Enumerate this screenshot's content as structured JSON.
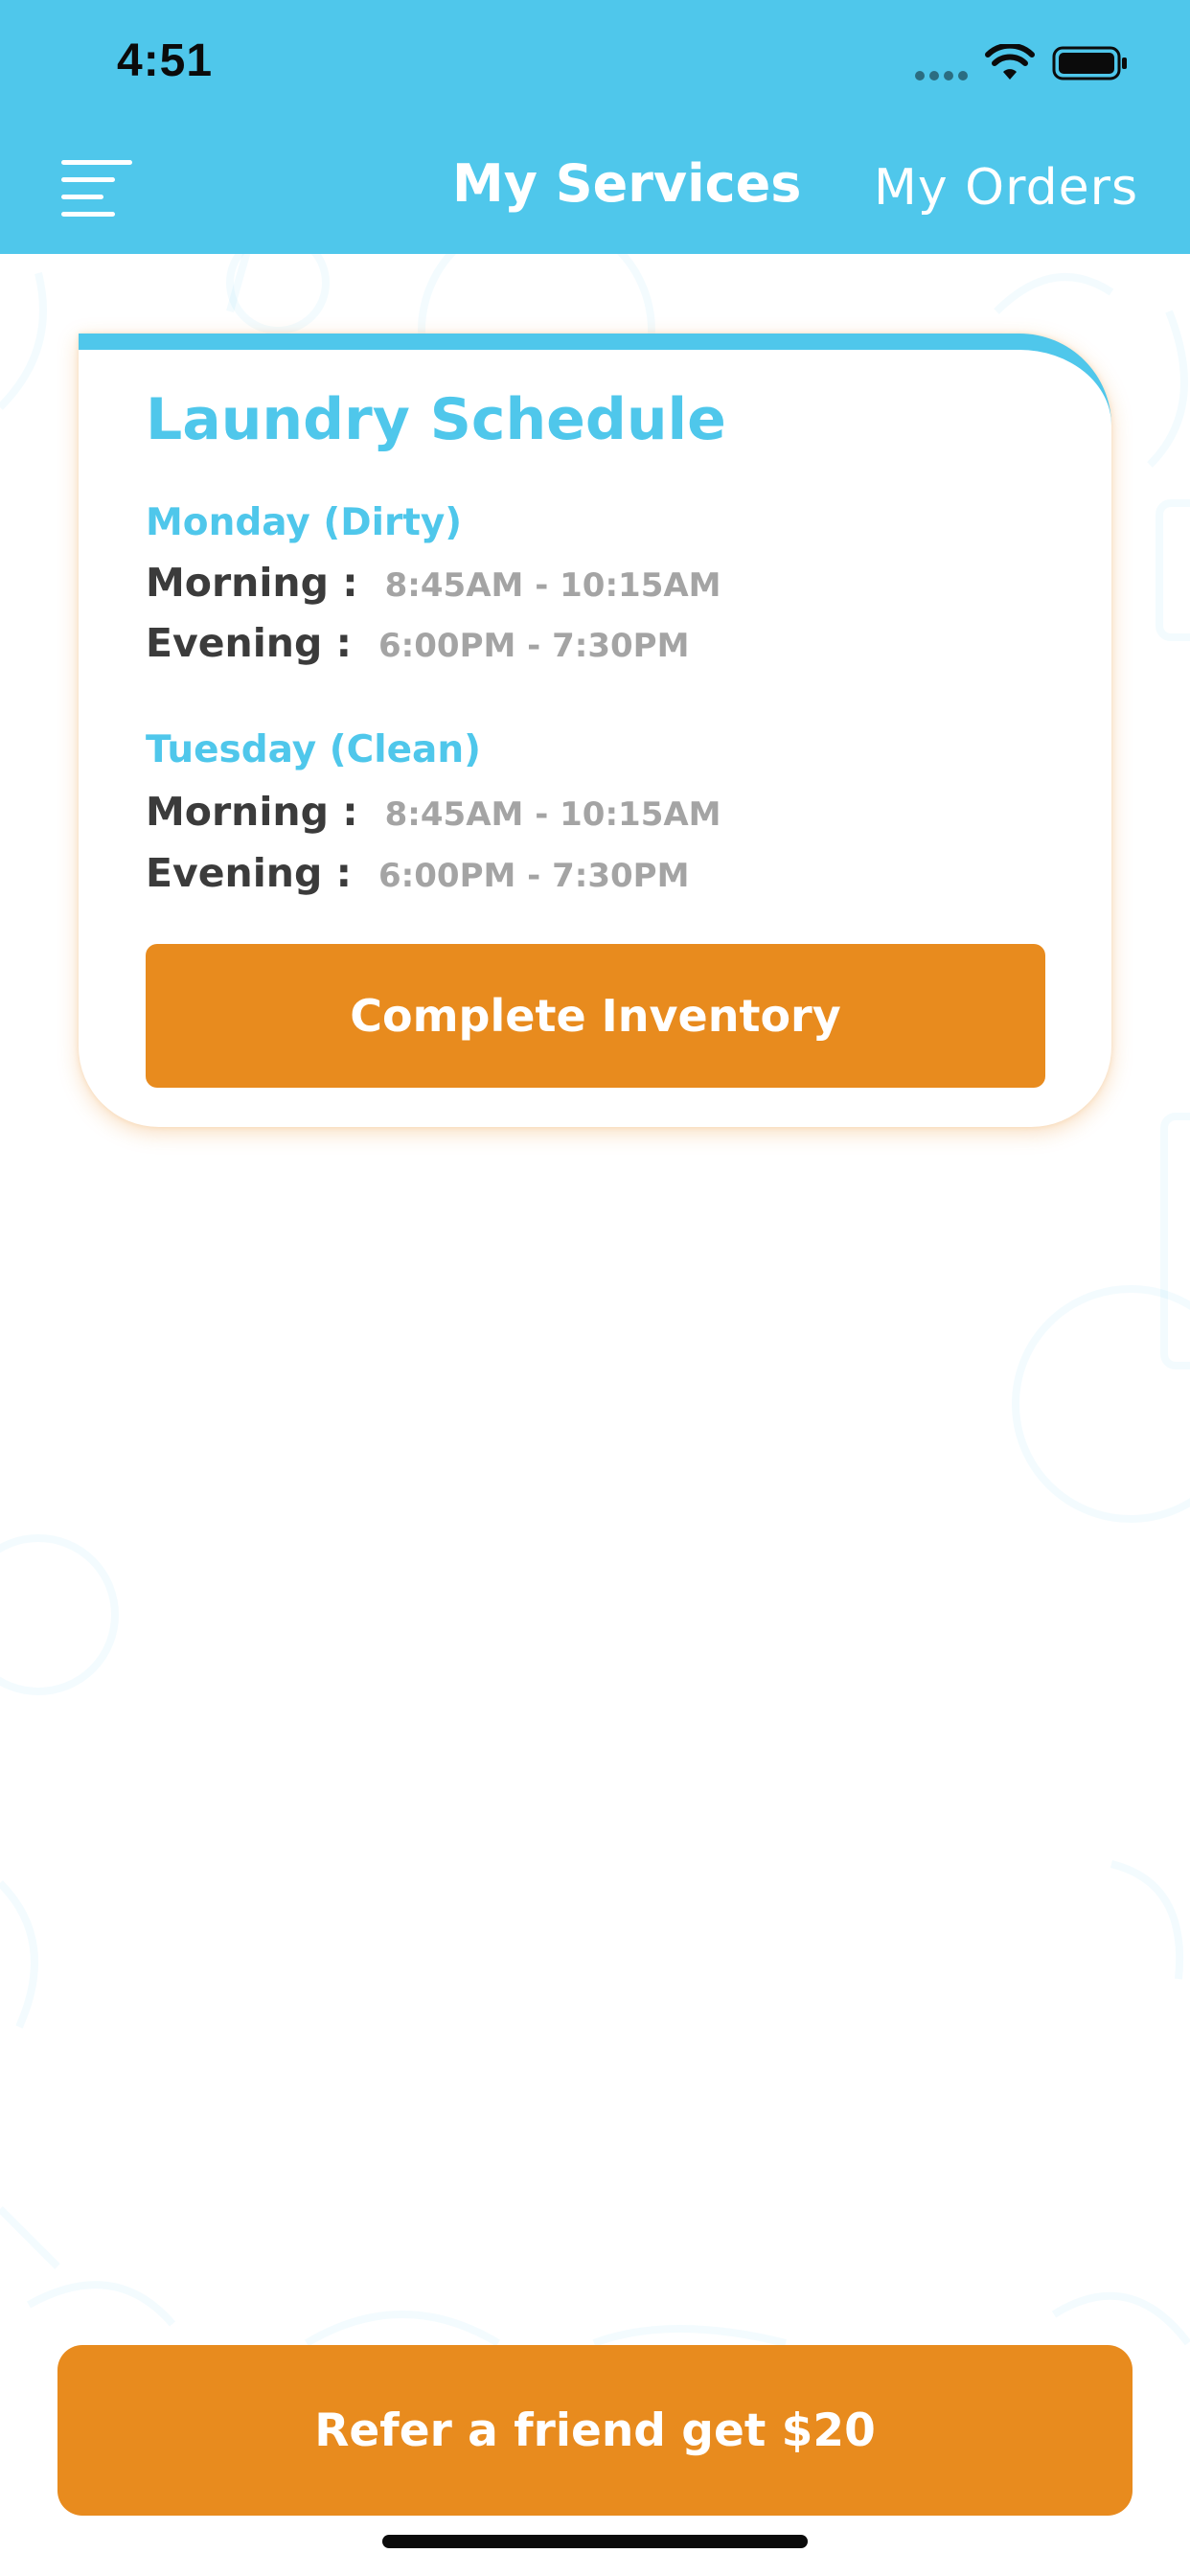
{
  "status_bar": {
    "time": "4:51"
  },
  "header": {
    "menu_icon": "hamburger-menu-icon",
    "active_tab": "My Services",
    "inactive_tab": "My Orders"
  },
  "schedule": {
    "title": "Laundry Schedule",
    "days": [
      {
        "label": "Monday (Dirty)",
        "slots": [
          {
            "label": "Morning :",
            "time": "8:45AM - 10:15AM"
          },
          {
            "label": "Evening :",
            "time": "6:00PM - 7:30PM"
          }
        ]
      },
      {
        "label": "Tuesday (Clean)",
        "slots": [
          {
            "label": "Morning :",
            "time": "8:45AM - 10:15AM"
          },
          {
            "label": "Evening :",
            "time": "6:00PM - 7:30PM"
          }
        ]
      }
    ],
    "button_label": "Complete Inventory"
  },
  "footer": {
    "refer_label": "Refer a friend get $20"
  },
  "colors": {
    "primary_blue": "#4fc7eb",
    "accent_orange": "#e88b1e",
    "label_dark": "#3b3b3b",
    "value_gray": "#a4a4a4"
  }
}
